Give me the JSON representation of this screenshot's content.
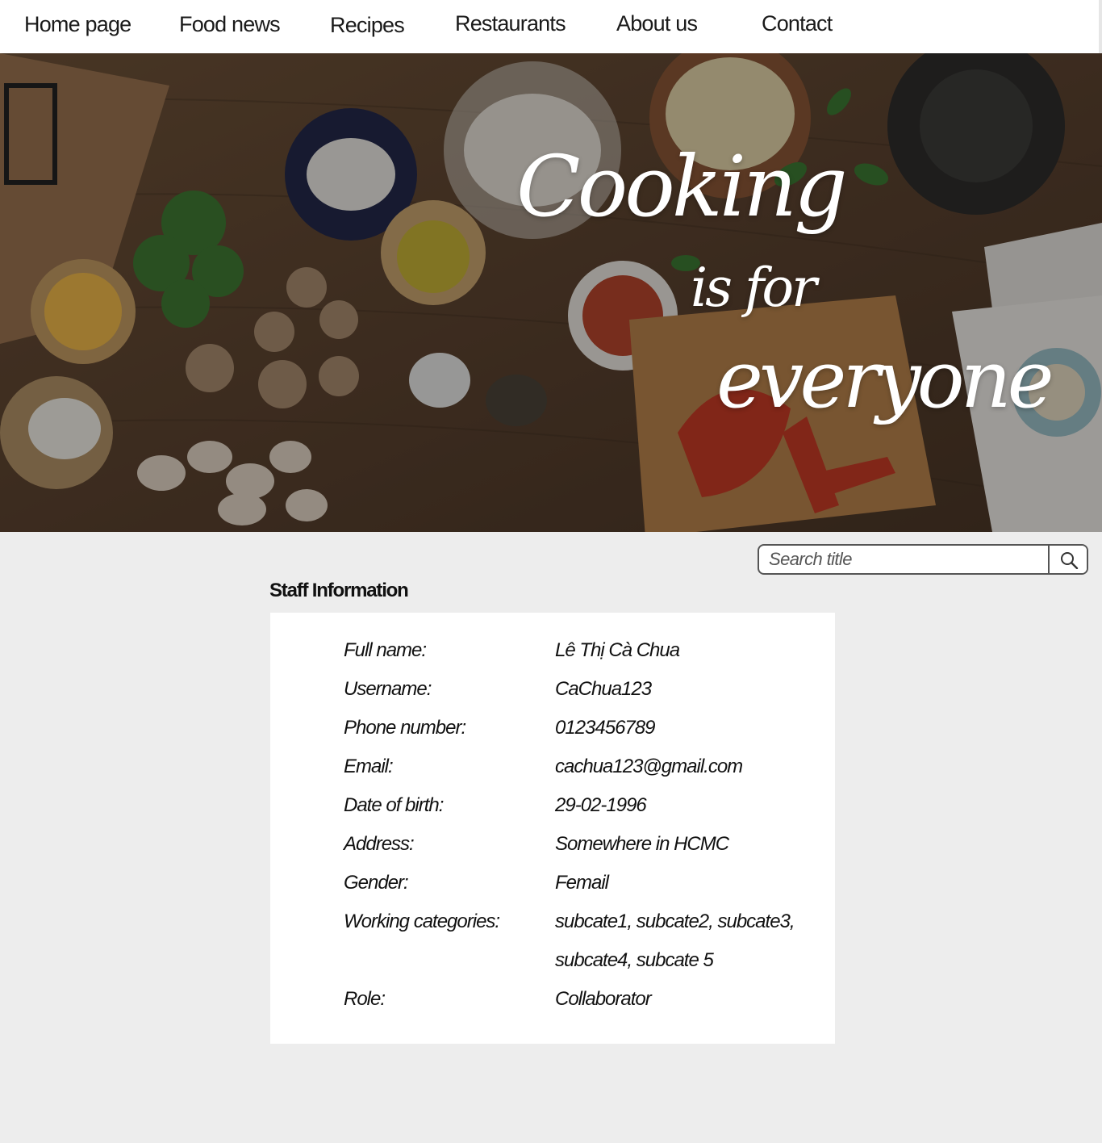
{
  "nav": {
    "items": [
      {
        "label": "Home page"
      },
      {
        "label": "Food news"
      },
      {
        "label": "Recipes"
      },
      {
        "label": "Restaurants"
      },
      {
        "label": "About us"
      },
      {
        "label": "Contact"
      }
    ]
  },
  "hero": {
    "line1": "Cooking",
    "line2": "is for",
    "line3": "everyone"
  },
  "search": {
    "placeholder": "Search title",
    "icon": "search-icon"
  },
  "staff": {
    "title": "Staff Information",
    "fields": [
      {
        "label": "Full name:",
        "value": "Lê Thị Cà Chua"
      },
      {
        "label": "Username:",
        "value": "CaChua123"
      },
      {
        "label": "Phone number:",
        "value": "0123456789"
      },
      {
        "label": "Email:",
        "value": "cachua123@gmail.com"
      },
      {
        "label": "Date of birth:",
        "value": "29-02-1996"
      },
      {
        "label": "Address:",
        "value": "Somewhere in HCMC"
      },
      {
        "label": "Gender:",
        "value": "Femail"
      },
      {
        "label": "Working categories:",
        "value": "subcate1, subcate2, subcate3,",
        "value_line2": "subcate4, subcate 5"
      },
      {
        "label": "Role:",
        "value": "Collaborator"
      }
    ]
  },
  "colors": {
    "page_bg": "#ededed",
    "nav_bg": "#ffffff",
    "card_bg": "#ffffff",
    "text": "#111111"
  }
}
